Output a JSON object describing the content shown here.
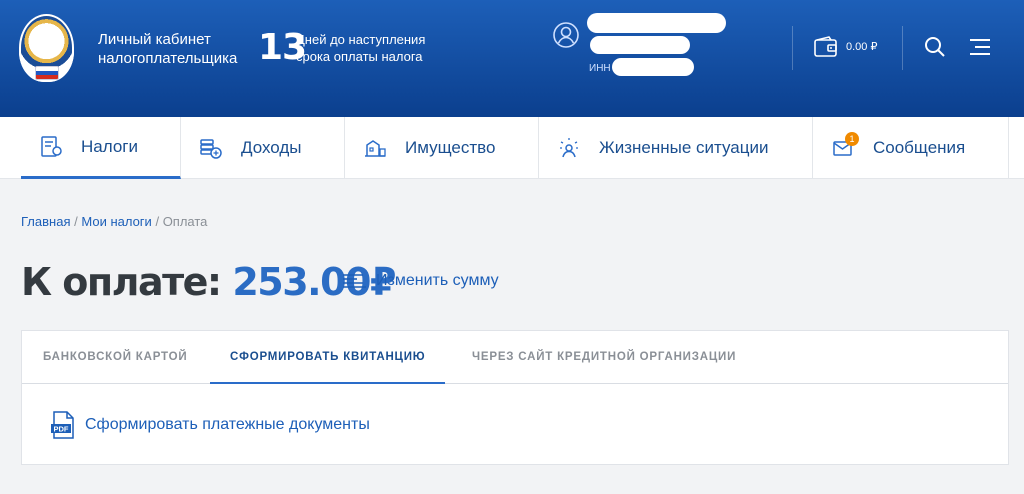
{
  "header": {
    "brand": "Личный кабинет налогоплательщика",
    "days_count": "13",
    "days_text": "Дней до наступления срока оплаты налога",
    "inn_label": "ИНН",
    "balance": "0.00 ₽"
  },
  "nav": {
    "items": [
      {
        "label": "Налоги",
        "icon": "taxes-icon"
      },
      {
        "label": "Доходы",
        "icon": "income-icon"
      },
      {
        "label": "Имущество",
        "icon": "property-icon"
      },
      {
        "label": "Жизненные ситуации",
        "icon": "life-situations-icon"
      },
      {
        "label": "Сообщения",
        "icon": "messages-icon",
        "badge": "1"
      }
    ]
  },
  "breadcrumb": {
    "home": "Главная",
    "sep": "/",
    "my_taxes": "Мои налоги",
    "current": "Оплата"
  },
  "payment": {
    "label": "К оплате:",
    "amount": "253.00₽",
    "change_sum": "Изменить сумму"
  },
  "tabs": [
    {
      "label": "Банковской картой"
    },
    {
      "label": "Сформировать квитанцию"
    },
    {
      "label": "Через сайт кредитной организации"
    }
  ],
  "content": {
    "generate_docs": "Сформировать платежные документы"
  },
  "colors": {
    "header_bg": "#0b3f8e",
    "accent": "#2a6cc9",
    "badge": "#f08a00"
  }
}
